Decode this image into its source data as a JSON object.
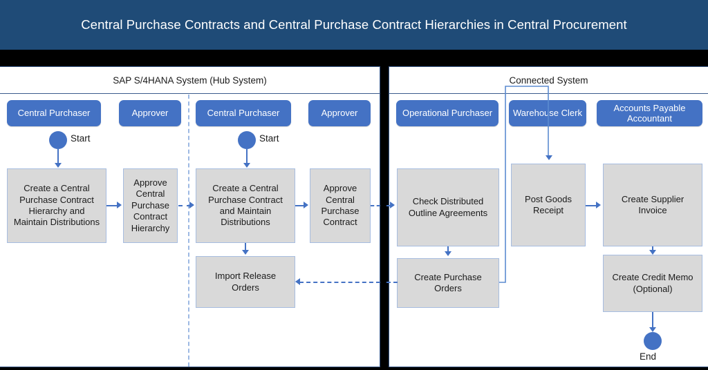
{
  "title": "Central Purchase Contracts and Central Purchase Contract Hierarchies in Central Procurement",
  "colors": {
    "title_bar": "#1F4B77",
    "accent_blue": "#4472C4",
    "task_fill": "#D9D9D9",
    "task_border": "#A6BCE0",
    "pool_border": "#3A5A8C",
    "divider": "#000000"
  },
  "pools": [
    {
      "id": "hub",
      "label": "SAP S/4HANA System (Hub System)"
    },
    {
      "id": "connected",
      "label": "Connected System"
    }
  ],
  "roles": [
    {
      "id": "central-purchaser-1",
      "label": "Central Purchaser",
      "pool": "hub"
    },
    {
      "id": "approver-1",
      "label": "Approver",
      "pool": "hub"
    },
    {
      "id": "central-purchaser-2",
      "label": "Central Purchaser",
      "pool": "hub"
    },
    {
      "id": "approver-2",
      "label": "Approver",
      "pool": "hub"
    },
    {
      "id": "operational-purchaser",
      "label": "Operational Purchaser",
      "pool": "connected"
    },
    {
      "id": "warehouse-clerk",
      "label": "Warehouse Clerk",
      "pool": "connected"
    },
    {
      "id": "accounts-payable-accountant",
      "label": "Accounts Payable Accountant",
      "pool": "connected"
    }
  ],
  "events": [
    {
      "id": "start-1",
      "label": "Start",
      "type": "start"
    },
    {
      "id": "start-2",
      "label": "Start",
      "type": "start"
    },
    {
      "id": "end-1",
      "label": "End",
      "type": "end"
    }
  ],
  "tasks": [
    {
      "id": "create-hierarchy",
      "label": "Create a Central Purchase Contract Hierarchy and Maintain Distributions"
    },
    {
      "id": "approve-hierarchy",
      "label": "Approve Central Purchase Contract Hierarchy"
    },
    {
      "id": "create-contract",
      "label": "Create a Central Purchase Contract and Maintain Distributions"
    },
    {
      "id": "approve-contract",
      "label": "Approve Central Purchase Contract"
    },
    {
      "id": "import-release-orders",
      "label": "Import Release Orders"
    },
    {
      "id": "check-outline-agreements",
      "label": "Check Distributed Outline Agreements"
    },
    {
      "id": "create-purchase-orders",
      "label": "Create Purchase Orders"
    },
    {
      "id": "post-goods-receipt",
      "label": "Post Goods Receipt"
    },
    {
      "id": "create-supplier-invoice",
      "label": "Create Supplier Invoice"
    },
    {
      "id": "create-credit-memo",
      "label": "Create Credit Memo (Optional)"
    }
  ],
  "flows": [
    {
      "from": "start-1",
      "to": "create-hierarchy",
      "style": "solid"
    },
    {
      "from": "create-hierarchy",
      "to": "approve-hierarchy",
      "style": "solid"
    },
    {
      "from": "approve-hierarchy",
      "to": "create-contract",
      "style": "dashed"
    },
    {
      "from": "start-2",
      "to": "create-contract",
      "style": "solid"
    },
    {
      "from": "create-contract",
      "to": "approve-contract",
      "style": "solid"
    },
    {
      "from": "create-contract",
      "to": "import-release-orders",
      "style": "solid"
    },
    {
      "from": "approve-contract",
      "to": "check-outline-agreements",
      "style": "dashed"
    },
    {
      "from": "check-outline-agreements",
      "to": "create-purchase-orders",
      "style": "solid"
    },
    {
      "from": "create-purchase-orders",
      "to": "post-goods-receipt",
      "style": "solid"
    },
    {
      "from": "create-purchase-orders",
      "to": "import-release-orders",
      "style": "dashed"
    },
    {
      "from": "post-goods-receipt",
      "to": "create-supplier-invoice",
      "style": "solid"
    },
    {
      "from": "create-supplier-invoice",
      "to": "create-credit-memo",
      "style": "solid"
    },
    {
      "from": "create-credit-memo",
      "to": "end-1",
      "style": "solid"
    }
  ]
}
